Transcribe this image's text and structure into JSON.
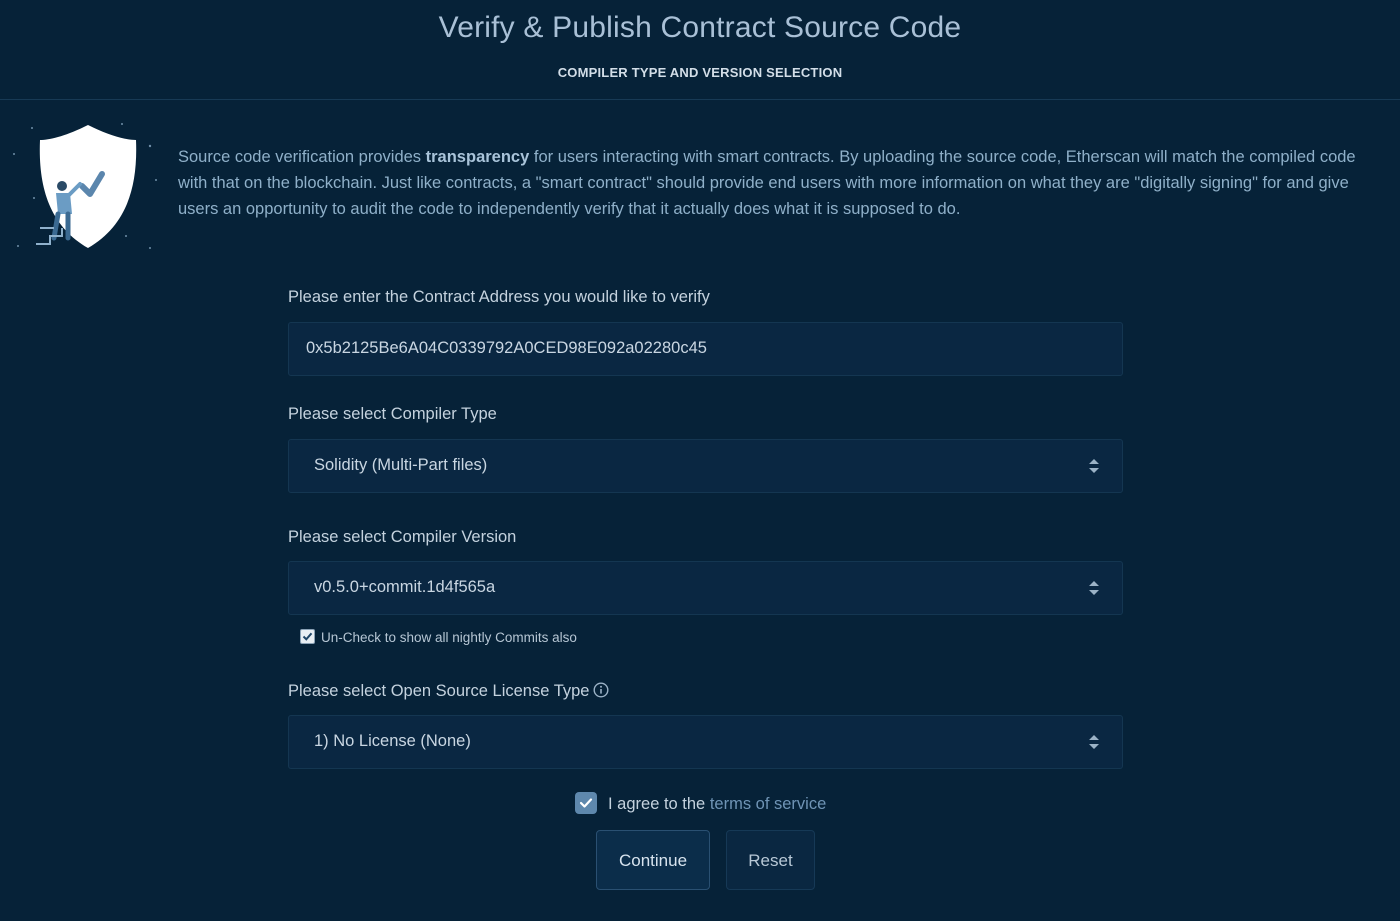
{
  "header": {
    "title": "Verify & Publish Contract Source Code",
    "subtitle": "COMPILER TYPE AND VERSION SELECTION"
  },
  "intro": {
    "text_before": "Source code verification provides ",
    "text_bold": "transparency",
    "text_after": " for users interacting with smart contracts. By uploading the source code, Etherscan will match the compiled code with that on the blockchain. Just like contracts, a \"smart contract\" should provide end users with more information on what they are \"digitally signing\" for and give users an opportunity to audit the code to independently verify that it actually does what it is supposed to do.",
    "illustration_icon": "shield-check-icon"
  },
  "form": {
    "address": {
      "label": "Please enter the Contract Address you would like to verify",
      "value": "0x5b2125Be6A04C0339792A0CED98E092a02280c45"
    },
    "compiler_type": {
      "label": "Please select Compiler Type",
      "value": "Solidity (Multi-Part files)"
    },
    "compiler_version": {
      "label": "Please select Compiler Version",
      "value": "v0.5.0+commit.1d4f565a"
    },
    "nightly": {
      "label": "Un-Check to show all nightly Commits also",
      "checked": true
    },
    "license": {
      "label": "Please select Open Source License Type",
      "value": "1) No License (None)",
      "info_icon": "info-icon"
    },
    "agree": {
      "text": "I agree to the ",
      "link": "terms of service",
      "checked": true
    },
    "buttons": {
      "continue": "Continue",
      "reset": "Reset"
    }
  },
  "colors": {
    "background": "#062238",
    "accent": "#5e88ad",
    "link": "#6f94b5"
  }
}
